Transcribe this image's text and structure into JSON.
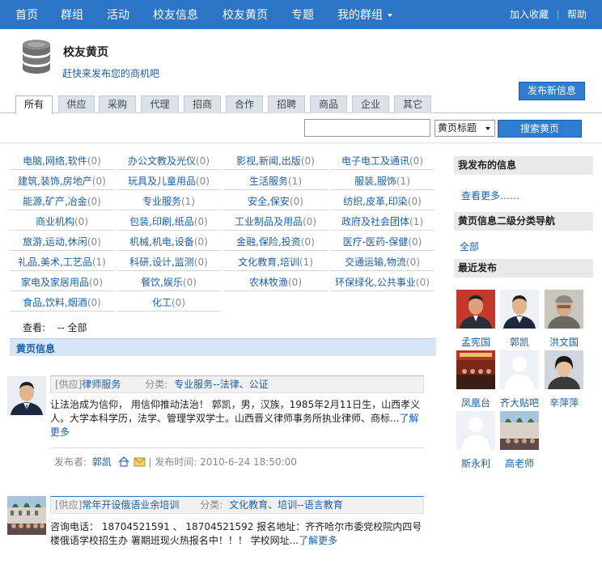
{
  "nav": {
    "items": [
      "首页",
      "群组",
      "活动",
      "校友信息",
      "校友黄页",
      "专题",
      "我的群组"
    ],
    "bookmark": "加入收藏",
    "help": "帮助"
  },
  "header": {
    "title": "校友黄页",
    "subtitle": "赶快来发布您的商机吧",
    "publish_btn": "发布新信息"
  },
  "tabs": [
    "所有",
    "供应",
    "采购",
    "代理",
    "招商",
    "合作",
    "招聘",
    "商品",
    "企业",
    "其它"
  ],
  "search": {
    "input_value": "",
    "select_value": "黄页标题",
    "button": "搜索黄页"
  },
  "categories": [
    {
      "name": "电脑,网络,软件",
      "count": "(0)"
    },
    {
      "name": "办公文教及光仪",
      "count": "(0)"
    },
    {
      "name": "影视,新闻,出版",
      "count": "(0)"
    },
    {
      "name": "电子电工及通讯",
      "count": "(0)"
    },
    {
      "name": "建筑,装饰,房地产",
      "count": "(0)"
    },
    {
      "name": "玩具及儿童用品",
      "count": "(0)"
    },
    {
      "name": "生活服务",
      "count": "(1)"
    },
    {
      "name": "服装,服饰",
      "count": "(1)"
    },
    {
      "name": "能源,矿产,冶金",
      "count": "(0)"
    },
    {
      "name": "专业服务",
      "count": "(1)"
    },
    {
      "name": "安全,保安",
      "count": "(0)"
    },
    {
      "name": "纺织,皮革,印染",
      "count": "(0)"
    },
    {
      "name": "商业机构",
      "count": "(0)"
    },
    {
      "name": "包装,印刷,纸品",
      "count": "(0)"
    },
    {
      "name": "工业制品及用品",
      "count": "(0)"
    },
    {
      "name": "政府及社会团体",
      "count": "(1)"
    },
    {
      "name": "旅游,运动,休闲",
      "count": "(0)"
    },
    {
      "name": "机械,机电,设备",
      "count": "(0)"
    },
    {
      "name": "金融,保险,投资",
      "count": "(0)"
    },
    {
      "name": "医疗-医药-保健",
      "count": "(0)"
    },
    {
      "name": "礼品,美术,工艺品",
      "count": "(1)"
    },
    {
      "name": "科研,设计,监测",
      "count": "(0)"
    },
    {
      "name": "文化教育,培训",
      "count": "(1)"
    },
    {
      "name": "交通运输,物流",
      "count": "(0)"
    },
    {
      "name": "家电及家居用品",
      "count": "(0)"
    },
    {
      "name": "餐饮,娱乐",
      "count": "(0)"
    },
    {
      "name": "农林牧渔",
      "count": "(0)"
    },
    {
      "name": "环保绿化,公共事业",
      "count": "(0)"
    },
    {
      "name": "食品,饮料,烟酒",
      "count": "(0)"
    },
    {
      "name": "化工",
      "count": "(0)"
    }
  ],
  "view": {
    "label": "查看:",
    "value": "-- 全部"
  },
  "section_title": "黄页信息",
  "entries": [
    {
      "type": "[供应]",
      "title": "律师服务",
      "category_label": "分类:",
      "category": "专业服务--法律、公证",
      "body": "让法治成为信仰， 用信仰推动法治！ 郭凯，男，汉族，1985年2月11日生，山西孝义人。大学本科学历，法学、管理学双学士。山西晋义律师事务所执业律师、商标...",
      "more": "了解更多",
      "publisher_label": "发布者:",
      "publisher": "郭凯",
      "time_label": "| 发布时间:",
      "time": "2010-6-24 18:50:00"
    },
    {
      "type": "[供应]",
      "title": "常年开设俄语业余培训",
      "category_label": "分类:",
      "category": "文化教育、培训--语言教育",
      "body": "咨询电话： 18704521591 、 18704521592 报名地址：齐齐哈尔市委党校院内四号楼俄语学校招生办 署期班现火热报名中！！！ 学校网址...",
      "more": "了解更多"
    }
  ],
  "sidebar": {
    "my_info_title": "我发布的信息",
    "view_more": "查看更多……",
    "nav_title": "黄页信息二级分类导航",
    "all": "全部",
    "recent_title": "最近发布",
    "users": [
      "孟宪国",
      "郭凯",
      "洪文国",
      "凤凰台",
      "齐大贴吧",
      "辛萍萍",
      "斯永利",
      "高老师"
    ]
  },
  "colors": {
    "nav_bg": "#2b74c6",
    "link": "#1a5fa8",
    "section_bg": "#d6e6f7"
  }
}
